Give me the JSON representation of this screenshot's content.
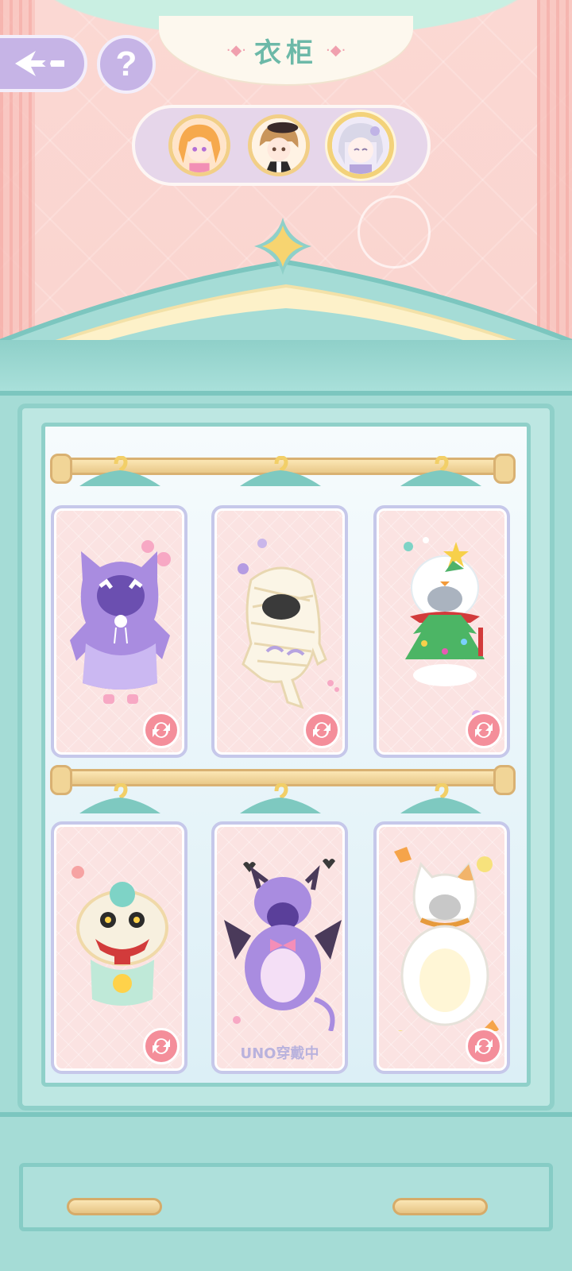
{
  "header": {
    "title": "衣柜",
    "back_icon": "back-arrow-icon",
    "help_label": "?"
  },
  "characters": [
    {
      "name": "orange-hair-girl",
      "selected": false
    },
    {
      "name": "brown-hair-boy",
      "selected": false
    },
    {
      "name": "silver-hair-character",
      "selected": true
    }
  ],
  "wardrobe": {
    "rows": [
      {
        "items": [
          {
            "costume": "purple-cat-hoodie",
            "action_icon": "swap-icon",
            "hanger_label": "?"
          },
          {
            "costume": "mummy-costume",
            "action_icon": "swap-icon",
            "hanger_label": "?"
          },
          {
            "costume": "snowman-christmas-tree",
            "action_icon": "swap-icon",
            "hanger_label": "?"
          }
        ]
      },
      {
        "items": [
          {
            "costume": "lion-dance-costume",
            "action_icon": "swap-icon",
            "hanger_label": "?"
          },
          {
            "costume": "purple-devil-suit",
            "status_label": "UNO穿戴中",
            "hanger_label": "?"
          },
          {
            "costume": "calico-cat-suit",
            "action_icon": "swap-icon",
            "hanger_label": "?"
          }
        ]
      }
    ]
  },
  "colors": {
    "wardrobe": "#a5dcd6",
    "card_bg": "#fbe3e2",
    "card_border": "#c6c8ea",
    "accent_pink": "#f48e9a",
    "title": "#6cb9a8",
    "button_purple": "#c6b4e6"
  }
}
